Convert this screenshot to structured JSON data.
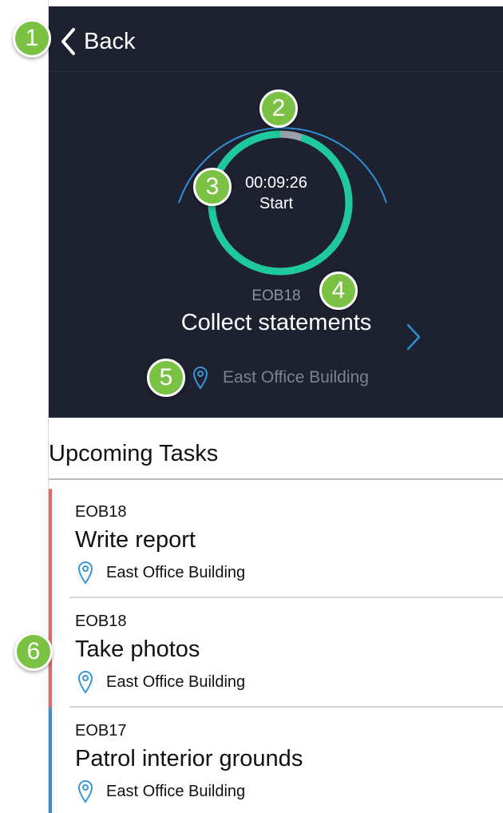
{
  "nav": {
    "back_label": "Back"
  },
  "timer": {
    "time": "00:09:26",
    "action_label": "Start",
    "progress": 0.95
  },
  "current_task": {
    "code": "EOB18",
    "title": "Collect statements",
    "location": "East Office Building"
  },
  "upcoming": {
    "title": "Upcoming Tasks",
    "items": [
      {
        "code": "EOB18",
        "title": "Write report",
        "location": "East Office Building",
        "color": "#e06a6a"
      },
      {
        "code": "EOB18",
        "title": "Take photos",
        "location": "East Office Building",
        "color": "#e06a6a"
      },
      {
        "code": "EOB17",
        "title": "Patrol interior grounds",
        "location": "East Office Building",
        "color": "#3b8fd0"
      }
    ]
  },
  "callouts": [
    "1",
    "2",
    "3",
    "4",
    "5",
    "6"
  ],
  "colors": {
    "header_bg": "#1e2230",
    "ring": "#1ec99b",
    "outer_arc": "#2f8fd6",
    "callout": "#7bc143",
    "pin": "#3a95d8"
  }
}
